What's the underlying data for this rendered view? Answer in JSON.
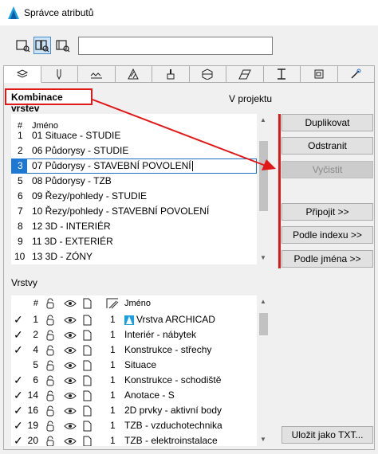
{
  "window": {
    "title": "Správce atributů"
  },
  "search": {
    "placeholder": "",
    "value": ""
  },
  "combo_section": {
    "label": "Kombinace vrstev",
    "project_label": "V projektu"
  },
  "combo_list": {
    "headers": {
      "num": "#",
      "name": "Jméno"
    },
    "rows": [
      {
        "num": "1",
        "name": "01 Situace - STUDIE"
      },
      {
        "num": "2",
        "name": "06 Půdorysy - STUDIE"
      },
      {
        "num": "3",
        "name": "07 Půdorysy - STAVEBNÍ POVOLENÍ"
      },
      {
        "num": "5",
        "name": "08 Půdorysy - TZB"
      },
      {
        "num": "6",
        "name": "09 Řezy/pohledy - STUDIE"
      },
      {
        "num": "7",
        "name": "10 Řezy/pohledy - STAVEBNÍ POVOLENÍ"
      },
      {
        "num": "8",
        "name": "12 3D - INTERIÉR"
      },
      {
        "num": "9",
        "name": "11 3D - EXTERIÉR"
      },
      {
        "num": "10",
        "name": "13 3D - ZÓNY"
      }
    ]
  },
  "buttons": {
    "duplicate": "Duplikovat",
    "delete": "Odstranit",
    "clear": "Vyčistit",
    "attach": "Připojit >>",
    "by_index": "Podle indexu >>",
    "by_name": "Podle jména >>",
    "save_txt": "Uložit jako TXT..."
  },
  "layers_section": {
    "label": "Vrstvy"
  },
  "layer_list": {
    "headers": {
      "num": "#",
      "name": "Jméno"
    },
    "rows": [
      {
        "checked": "✓",
        "num": "1",
        "pen": "1",
        "name": "Vrstva ARCHICAD",
        "special": true
      },
      {
        "checked": "✓",
        "num": "2",
        "pen": "1",
        "name": "Interiér - nábytek"
      },
      {
        "checked": "✓",
        "num": "4",
        "pen": "1",
        "name": "Konstrukce - střechy"
      },
      {
        "checked": "",
        "num": "5",
        "pen": "1",
        "name": "Situace"
      },
      {
        "checked": "✓",
        "num": "6",
        "pen": "1",
        "name": "Konstrukce - schodiště"
      },
      {
        "checked": "✓",
        "num": "14",
        "pen": "1",
        "name": "Anotace - S"
      },
      {
        "checked": "✓",
        "num": "16",
        "pen": "1",
        "name": "2D prvky - aktivní body"
      },
      {
        "checked": "✓",
        "num": "19",
        "pen": "1",
        "name": "TZB - vzduchotechnika"
      },
      {
        "checked": "✓",
        "num": "20",
        "pen": "1",
        "name": "TZB - elektroinstalace"
      }
    ]
  },
  "colors": {
    "accent": "#1e78d2",
    "annotation": "#e21818"
  }
}
